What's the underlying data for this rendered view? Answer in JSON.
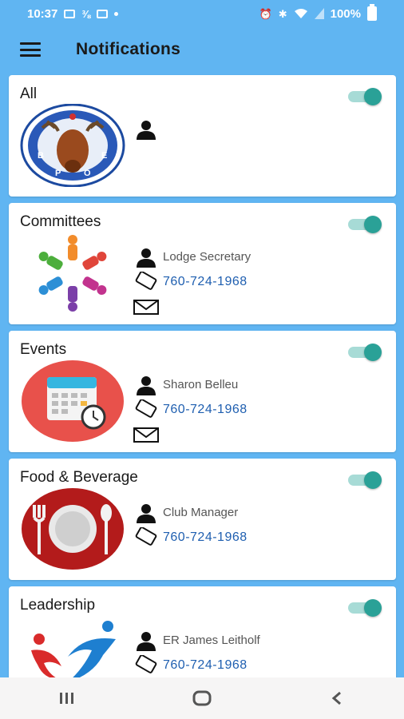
{
  "status_bar": {
    "time": "10:37",
    "battery": "100%",
    "left_icons": [
      "image-icon",
      "percent-icon",
      "linkedin-icon",
      "dot-icon"
    ],
    "right_icons": [
      "alarm-icon",
      "bluetooth-icon",
      "wifi-icon",
      "signal-icon",
      "battery-icon"
    ]
  },
  "app_bar": {
    "menu_icon": "menu-icon",
    "title": "Notifications"
  },
  "cards": [
    {
      "title": "All",
      "enabled": true,
      "logo": "bpoe-elk-logo",
      "contact": null,
      "phone": null,
      "email": false
    },
    {
      "title": "Committees",
      "enabled": true,
      "logo": "people-circle-logo",
      "contact": "Lodge Secretary",
      "phone": "760-724-1968",
      "email": true
    },
    {
      "title": "Events",
      "enabled": true,
      "logo": "calendar-clock-logo",
      "contact": "Sharon Belleu",
      "phone": "760-724-1968",
      "email": true
    },
    {
      "title": "Food & Beverage",
      "enabled": true,
      "logo": "plate-utensils-logo",
      "contact": "Club Manager",
      "phone": "760-724-1968",
      "email": false
    },
    {
      "title": "Leadership",
      "enabled": true,
      "logo": "swoosh-figure-logo",
      "contact": "ER James Leitholf",
      "phone": "760-724-1968",
      "email": true
    }
  ],
  "colors": {
    "background": "#60b5f2",
    "toggle_on": "#2aa197",
    "phone_link": "#1f5fb0"
  },
  "nav_bar": {
    "buttons": [
      "recents-icon",
      "home-icon",
      "back-icon"
    ]
  }
}
